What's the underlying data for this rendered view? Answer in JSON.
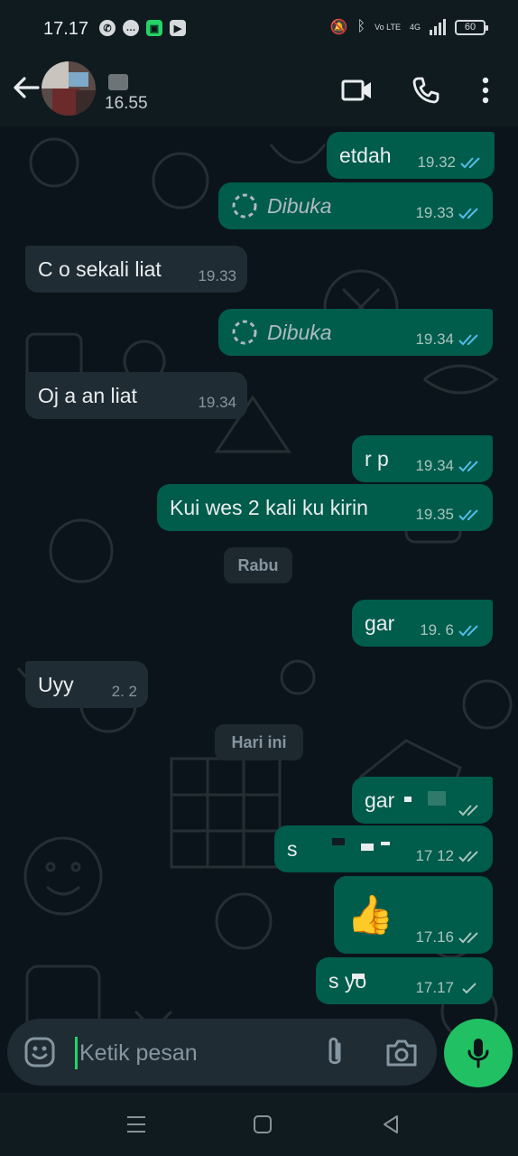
{
  "status_bar": {
    "time": "17.17",
    "lte_label": "Vo LTE",
    "network_label": "4G",
    "battery": "60"
  },
  "header": {
    "last_seen": "16.55"
  },
  "messages": [
    {
      "dir": "out",
      "text": "etdah",
      "time": "19.32",
      "status": "read"
    },
    {
      "dir": "out",
      "type": "view_once",
      "text": "Dibuka",
      "time": "19.33",
      "status": "read"
    },
    {
      "dir": "in",
      "text": "C  o sekali liat",
      "time": "19.33"
    },
    {
      "dir": "out",
      "type": "view_once",
      "text": "Dibuka",
      "time": "19.34",
      "status": "read"
    },
    {
      "dir": "in",
      "text": "Oj     a   an liat",
      "time": "19.34"
    },
    {
      "dir": "out",
      "text": "r  p",
      "time": "19.34",
      "status": "read"
    },
    {
      "dir": "out",
      "text": "Kui wes 2 kali ku kirin",
      "time": "19.35",
      "status": "read"
    },
    {
      "dir": "out",
      "text": "gar",
      "time": "19. 6",
      "status": "read"
    },
    {
      "dir": "in",
      "text": "Uyy",
      "time": "2.  2"
    },
    {
      "dir": "out",
      "text": "gar",
      "time": "",
      "status": "delivered"
    },
    {
      "dir": "out",
      "text": "s",
      "time": "17  12",
      "status": "delivered"
    },
    {
      "dir": "out",
      "type": "emoji",
      "text": "👍",
      "time": "17.16",
      "status": "delivered"
    },
    {
      "dir": "out",
      "text": "s    yo",
      "time": "17.17",
      "status": "sent"
    }
  ],
  "date_chips": [
    "Rabu",
    "Hari ini"
  ],
  "composer": {
    "placeholder": "Ketik pesan"
  },
  "colors": {
    "background": "#0b141a",
    "outgoing_bubble": "#005c4b",
    "incoming_bubble": "#202c33",
    "read_ticks": "#53bdeb",
    "accent_green": "#21c063"
  },
  "icons": [
    "back-arrow",
    "video-call",
    "voice-call",
    "more-vertical",
    "emoji",
    "attach",
    "camera",
    "microphone",
    "recents",
    "home",
    "back"
  ]
}
